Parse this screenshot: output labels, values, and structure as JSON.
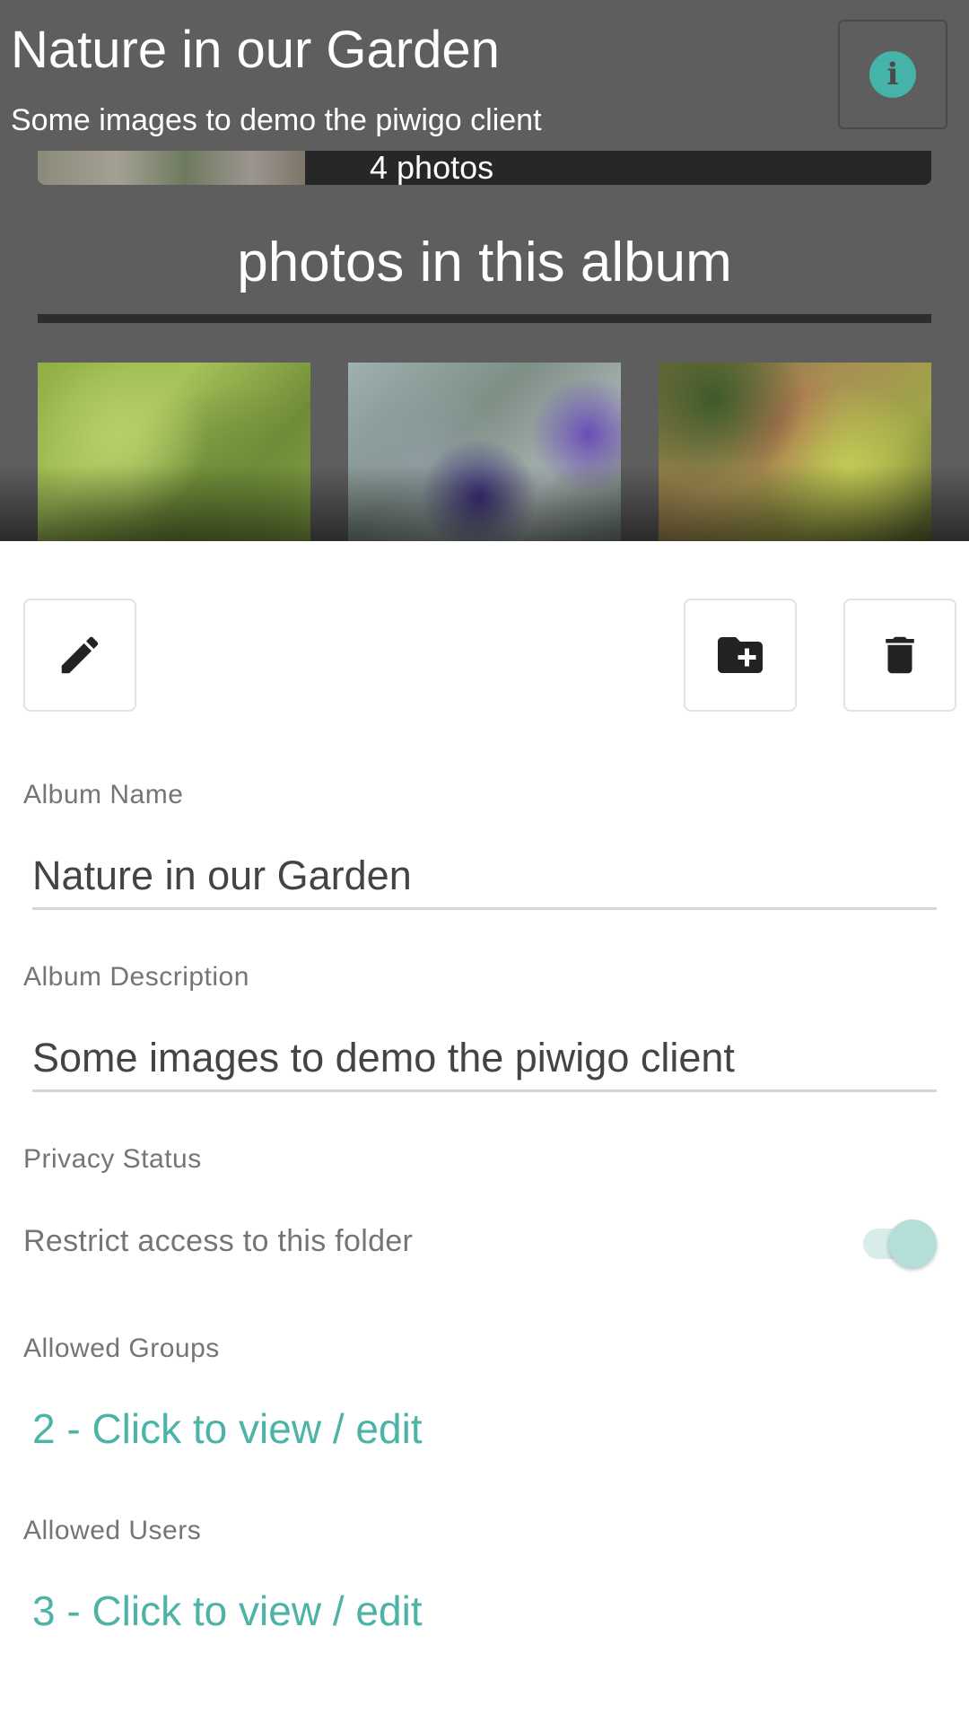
{
  "header": {
    "title": "Nature in our Garden",
    "subtitle": "Some images to demo the piwigo client",
    "info_icon_glyph": "i",
    "accent_color": "#46b3a8"
  },
  "gallery": {
    "sub_album_count": "4 photos",
    "section_heading": "photos in this album",
    "thumbnails": [
      "green-bamboo-leaves",
      "lavender-flowers",
      "autumn-maple-leaves"
    ]
  },
  "actions": {
    "edit_icon": "pencil-icon",
    "add_folder_icon": "folder-plus-icon",
    "delete_icon": "trash-icon"
  },
  "form": {
    "album_name_label": "Album Name",
    "album_name_value": "Nature in our Garden",
    "album_description_label": "Album Description",
    "album_description_value": "Some images to demo the piwigo client",
    "privacy_label": "Privacy Status",
    "restrict_label": "Restrict access to this folder",
    "restrict_enabled": true,
    "allowed_groups_label": "Allowed Groups",
    "allowed_groups_link": "2 - Click to view / edit",
    "allowed_users_label": "Allowed Users",
    "allowed_users_link": "3 - Click to view / edit",
    "link_color": "#4cb3a6"
  }
}
